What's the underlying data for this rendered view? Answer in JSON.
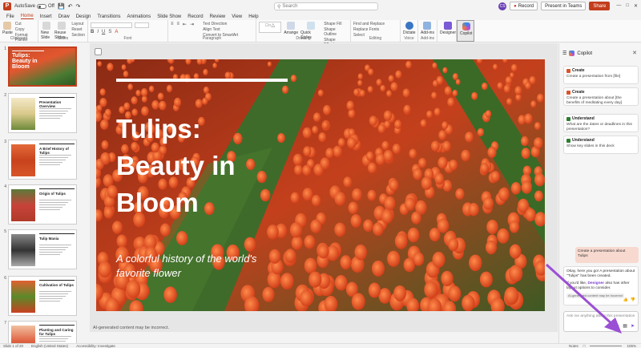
{
  "titlebar": {
    "autosave_label": "AutoSave",
    "autosave_state": "Off",
    "search_placeholder": "Search",
    "record_label": "Record",
    "present_label": "Present in Teams",
    "share_label": "Share",
    "avatar_initials": "CS"
  },
  "menu": [
    "File",
    "Home",
    "Insert",
    "Draw",
    "Design",
    "Transitions",
    "Animations",
    "Slide Show",
    "Record",
    "Review",
    "View",
    "Help"
  ],
  "ribbon": {
    "clipboard": {
      "label": "Clipboard",
      "paste": "Paste",
      "cut": "Cut",
      "copy": "Copy",
      "format": "Format Painter"
    },
    "slides": {
      "label": "Slides",
      "new_slide": "New Slide",
      "reuse": "Reuse Slides",
      "layout": "Layout",
      "reset": "Reset",
      "section": "Section"
    },
    "font": {
      "label": "Font"
    },
    "paragraph": {
      "label": "Paragraph",
      "text_direction": "Text Direction",
      "align_text": "Align Text",
      "smartart": "Convert to SmartArt"
    },
    "drawing": {
      "label": "Drawing",
      "arrange": "Arrange",
      "quick_styles": "Quick Styles",
      "shape_fill": "Shape Fill",
      "shape_outline": "Shape Outline",
      "shape_effects": "Shape Effects"
    },
    "editing": {
      "label": "Editing",
      "find": "Find and Replace",
      "replace": "Replace Fonts",
      "select": "Select"
    },
    "voice": {
      "label": "Voice",
      "dictate": "Dictate"
    },
    "addins": {
      "label": "Add-ins",
      "addins": "Add-ins"
    },
    "designer": "Designer",
    "copilot": "Copilot"
  },
  "slides": [
    {
      "num": "1",
      "title": "Tulips: Beauty in Bloom"
    },
    {
      "num": "2",
      "title": "Presentation Overview"
    },
    {
      "num": "3",
      "title": "A Brief History of Tulips"
    },
    {
      "num": "4",
      "title": "Origin of Tulips"
    },
    {
      "num": "5",
      "title": "Tulip Mania"
    },
    {
      "num": "6",
      "title": "Cultivation of Tulips"
    },
    {
      "num": "7",
      "title": "Planting and Caring for Tulips"
    }
  ],
  "main_slide": {
    "title": "Tulips: Beauty in Bloom",
    "subtitle": "A colorful history of the world's favorite flower"
  },
  "canvas_footer": "AI-generated content may be incorrect.",
  "copilot": {
    "title": "Copilot",
    "suggestions": [
      {
        "kind": "Create",
        "text": "Create a presentation from [file]",
        "color": "#d9542b"
      },
      {
        "kind": "Create",
        "text": "Create a presentation about [the benefits of meditating every day]",
        "color": "#d9542b"
      },
      {
        "kind": "Understand",
        "text": "What are the dates or deadlines in this presentation?",
        "color": "#2e7d32"
      },
      {
        "kind": "Understand",
        "text": "Show key slides in this deck",
        "color": "#2e7d32"
      }
    ],
    "user_message": "Create a presentation about Tulips",
    "bot_message_1": "Okay, here you go! A presentation about \"Tulips\" has been created.",
    "bot_message_2": "If you'd like,",
    "bot_link": "Designer",
    "bot_message_3": "also has other layout options to consider.",
    "ai_note": "AI-generated content may be incorrect",
    "input_placeholder": "Ask me anything about this presentation"
  },
  "statusbar": {
    "slide_info": "Slide 1 of 20",
    "language": "English (United States)",
    "accessibility": "Accessibility: Investigate",
    "notes": "Notes",
    "zoom": "106%"
  },
  "colors": {
    "accent": "#c43e1c",
    "copilot_purple": "#7a3fd1",
    "arrow": "#9b4fd4"
  }
}
